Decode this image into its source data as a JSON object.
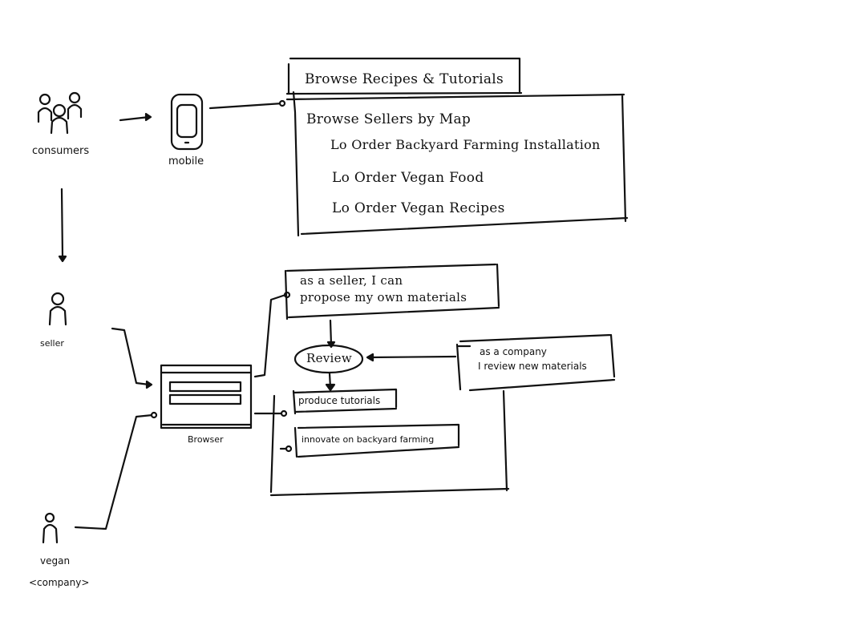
{
  "actors": {
    "consumers": "consumers",
    "mobile": "mobile",
    "seller": "seller",
    "browser": "Browser",
    "vegan_line1": "vegan",
    "vegan_line2": "<company>"
  },
  "mobile_box": {
    "header": "Browse Recipes & Tutorials",
    "title": "Browse Sellers by Map",
    "items": [
      "Lo Order Backyard Farming Installation",
      "Lo Order Vegan Food",
      "Lo Order Vegan Recipes"
    ]
  },
  "seller_box": {
    "line1": "as a seller, I can",
    "line2": "propose my own materials"
  },
  "review": "Review",
  "company_box": {
    "line1": "as a company",
    "line2": "I review new materials"
  },
  "produce": "produce tutorials",
  "innovate": "innovate on backyard farming"
}
